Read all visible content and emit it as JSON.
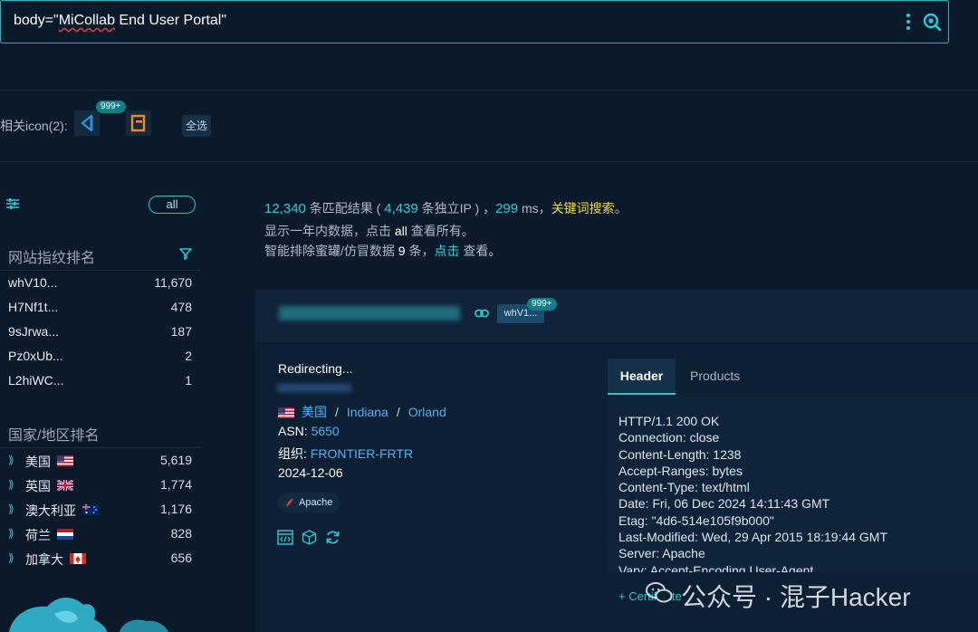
{
  "search": {
    "prefix": "body=\"",
    "squiggle": "MiCollab",
    "suffix": " End User Portal\""
  },
  "related": {
    "label": "相关icon(2):",
    "badge": "999+",
    "select_all": "全选"
  },
  "sidebar": {
    "filter_all": "all",
    "site_title": "网站指纹排名",
    "sites": [
      {
        "name": "whV10...",
        "count": "11,670"
      },
      {
        "name": "H7Nf1t...",
        "count": "478"
      },
      {
        "name": "9sJrwa...",
        "count": "187"
      },
      {
        "name": "Pz0xUb...",
        "count": "2"
      },
      {
        "name": "L2hiWC...",
        "count": "1"
      }
    ],
    "country_title": "国家/地区排名",
    "countries": [
      {
        "name": "美国",
        "flag": "us",
        "count": "5,619"
      },
      {
        "name": "英国",
        "flag": "gb",
        "count": "1,774"
      },
      {
        "name": "澳大利亚",
        "flag": "au",
        "count": "1,176"
      },
      {
        "name": "荷兰",
        "flag": "nl",
        "count": "828"
      },
      {
        "name": "加拿大",
        "flag": "ca",
        "count": "656"
      }
    ]
  },
  "stats": {
    "matches": "12,340",
    "t1": " 条匹配结果 ( ",
    "ips": "4,439",
    "t2": " 条独立IP ) ，",
    "ms": "299",
    "t3": " ms，",
    "keyword": "关键词搜索",
    "t4": "。",
    "line2a": "显示一年内数据，点击 ",
    "line2_all": "all",
    "line2b": " 查看所有。",
    "line3a": "智能排除蜜罐/仿冒数据 ",
    "line3_count": "9",
    "line3b": " 条，",
    "line3_click": "点击",
    "line3c": " 查看。"
  },
  "result": {
    "tag": "whV1...",
    "badge": "999+",
    "title": "Redirecting...",
    "loc_country": "美国",
    "loc_sep": "/",
    "loc_region": "Indiana",
    "loc_city": "Orland",
    "asn_label": "ASN: ",
    "asn": "5650",
    "org_label": "组织: ",
    "org": "FRONTIER-FRTR",
    "date": "2024-12-06",
    "server_tag": "Apache",
    "tabs": {
      "header": "Header",
      "products": "Products"
    },
    "header_lines": [
      "HTTP/1.1 200 OK",
      "Connection: close",
      "Content-Length: 1238",
      "Accept-Ranges: bytes",
      "Content-Type: text/html",
      "Date: Fri, 06 Dec 2024 14:11:43 GMT",
      "Etag: \"4d6-514e105f9b000\"",
      "Last-Modified: Wed, 29 Apr 2015 18:19:44 GMT",
      "Server: Apache",
      "Vary: Accept-Encoding,User-Agent"
    ],
    "certificate": "+ Certificate"
  },
  "watermark": "公众号 · 混子Hacker",
  "colors": {
    "accent": "#2ec3cf",
    "highlight": "#f5dd35",
    "link": "#4fb4f5",
    "background": "#0b1a2b"
  }
}
